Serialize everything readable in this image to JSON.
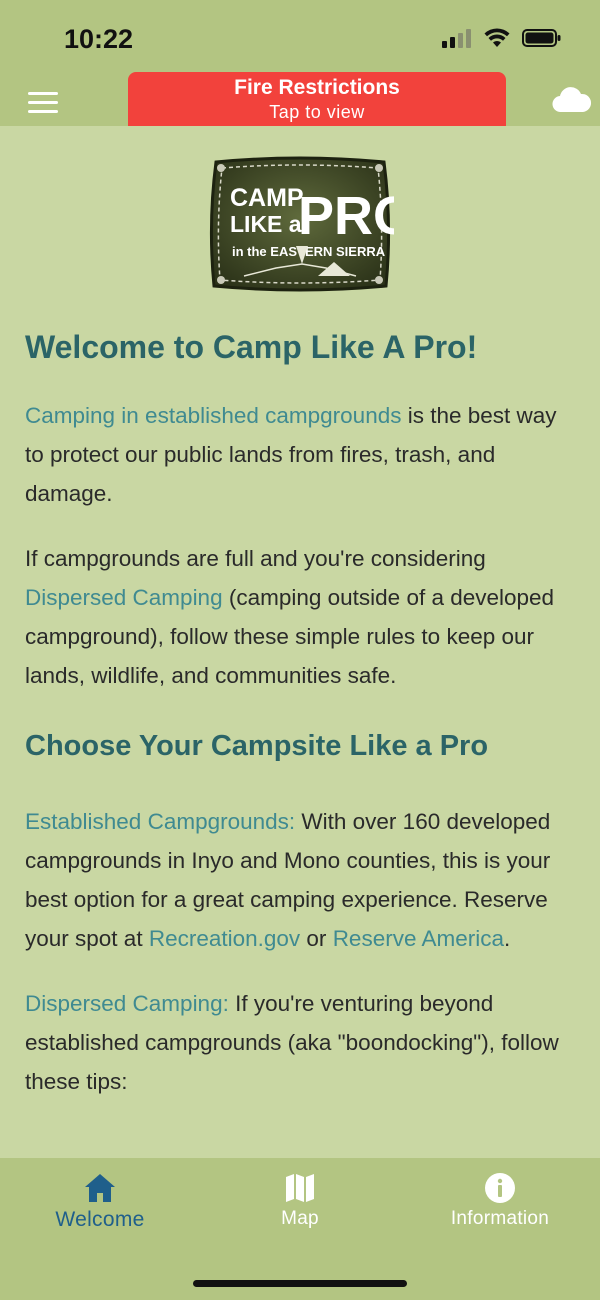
{
  "status": {
    "time": "10:22"
  },
  "header": {
    "banner_title": "Fire Restrictions",
    "banner_subtitle": "Tap to view"
  },
  "logo": {
    "line1": "CAMP",
    "line2": "LIKE a",
    "word": "PRO",
    "tagline": "in the EASTERN SIERRA"
  },
  "content": {
    "welcome_title": "Welcome to Camp Like A Pro!",
    "p1_link": "Camping in established campgrounds",
    "p1_text": " is the best way to protect our public lands from fires, trash, and damage.",
    "p2_text_a": "If campgrounds are full and you're considering ",
    "p2_link": "Dispersed Camping",
    "p2_text_b": " (camping outside of a developed campground), follow these simple rules to keep our lands, wildlife, and communities safe.",
    "choose_title": "Choose Your Campsite Like a Pro",
    "p3_link": "Established Campgrounds:",
    "p3_text_a": " With over 160 developed campgrounds in Inyo and Mono counties, this is your best option for a great camping experience. Reserve your spot at ",
    "p3_link2": "Recreation.gov",
    "p3_text_b": " or ",
    "p3_link3": "Reserve America",
    "p3_text_c": ".",
    "p4_link": "Dispersed Camping:",
    "p4_text": " If you're venturing beyond established campgrounds (aka \"boondocking\"), follow these tips:"
  },
  "tabs": [
    {
      "label": "Welcome",
      "icon": "home-icon",
      "active": true
    },
    {
      "label": "Map",
      "icon": "map-icon",
      "active": false
    },
    {
      "label": "Information",
      "icon": "info-icon",
      "active": false
    }
  ],
  "colors": {
    "header_bg": "#b3c582",
    "page_bg": "#c9d7a3",
    "banner_red": "#f2423c",
    "heading": "#2b6467",
    "link": "#3f8a91",
    "active_tab": "#1f5f8b"
  }
}
